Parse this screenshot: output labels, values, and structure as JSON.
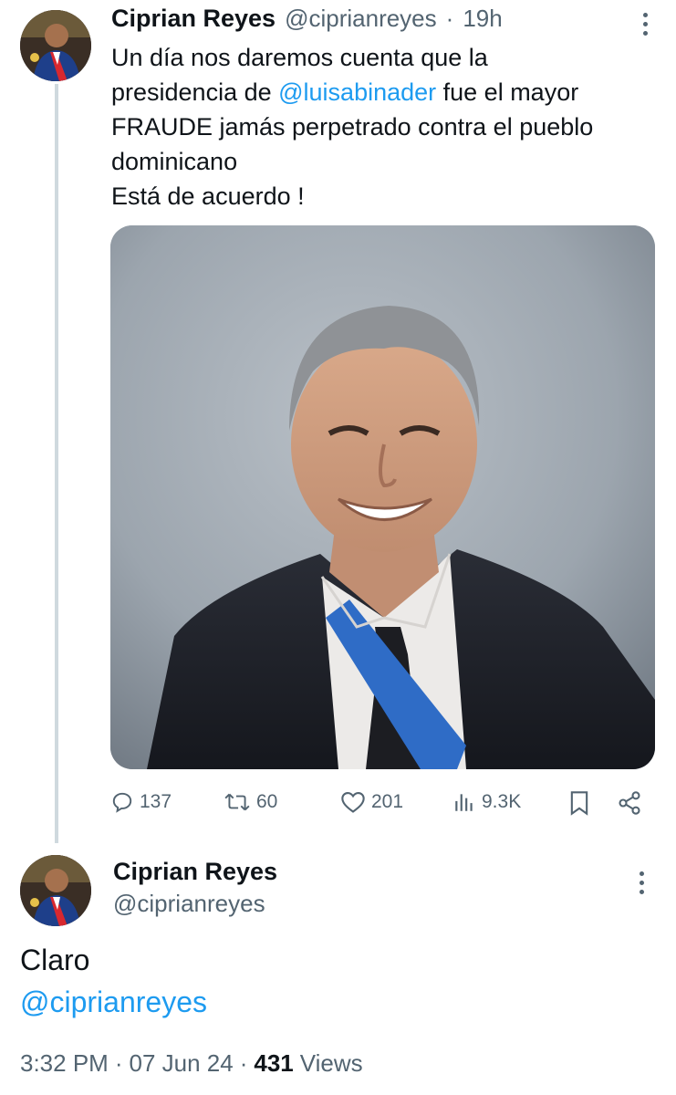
{
  "tweet": {
    "author_name": "Ciprian Reyes",
    "author_handle": "@ciprianreyes",
    "separator": "·",
    "time_ago": "19h",
    "text_line1": "Un día nos daremos cuenta que la",
    "text_line2_before": "presidencia de ",
    "mention": "@luisabinader",
    "text_line2_after": " fue el mayor",
    "text_line3": "FRAUDE jamás perpetrado contra el pueblo",
    "text_line4": "dominicano",
    "text_line5": "Está de acuerdo !",
    "actions": {
      "replies": "137",
      "retweets": "60",
      "likes": "201",
      "views": "9.3K"
    }
  },
  "reply": {
    "author_name": "Ciprian Reyes",
    "author_handle": "@ciprianreyes",
    "text": "Claro",
    "mention": "@ciprianreyes",
    "time": "3:32 PM",
    "date": "07 Jun 24",
    "separator": "·",
    "views_count": "431",
    "views_label": "Views"
  },
  "icons": {
    "reply": "comment-bubble-icon",
    "retweet": "retweet-arrows-icon",
    "like": "heart-icon",
    "views": "bar-chart-icon",
    "bookmark": "bookmark-icon",
    "share": "share-icon",
    "more": "vertical-dots-icon"
  },
  "colors": {
    "link": "#1d9bf0",
    "muted": "#536471",
    "text": "#0f1419",
    "thread_line": "#cfd9de"
  }
}
